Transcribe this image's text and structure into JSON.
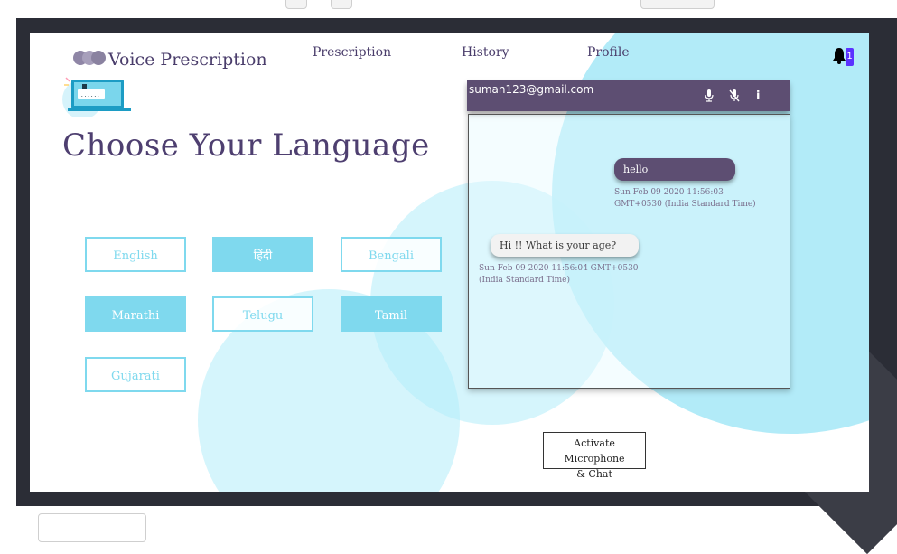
{
  "header": {
    "brand": "Voice Prescription",
    "nav": [
      "Prescription",
      "History",
      "Profile"
    ],
    "notification_count": "1"
  },
  "main": {
    "heading": "Choose Your Language",
    "languages": [
      {
        "label": "English",
        "selected": false
      },
      {
        "label": "हिंदी",
        "selected": true
      },
      {
        "label": "Bengali",
        "selected": false
      },
      {
        "label": "Marathi",
        "selected": true
      },
      {
        "label": "Telugu",
        "selected": false
      },
      {
        "label": "Tamil",
        "selected": true
      },
      {
        "label": "Gujarati",
        "selected": false
      }
    ]
  },
  "chat": {
    "email": "suman123@gmail.com",
    "icons": [
      "microphone-icon",
      "microphone-off-icon",
      "info-icon"
    ],
    "messages": [
      {
        "sender": "user",
        "text": "hello",
        "timestamp_line1": "Sun Feb 09 2020 11:56:03",
        "timestamp_line2": "GMT+0530 (India Standard Time)"
      },
      {
        "sender": "bot",
        "text": "Hi !! What is your age?",
        "timestamp_line1": "Sun Feb 09 2020 11:56:04 GMT+0530",
        "timestamp_line2": "(India Standard Time)"
      }
    ]
  },
  "activate_button": {
    "line1": "Activate Microphone",
    "line2": "& Chat"
  },
  "colors": {
    "brand_purple": "#5d4e72",
    "accent_cyan": "#7fd9ee",
    "notification_badge": "#5b32ff",
    "frame_dark": "#2b2d36"
  }
}
